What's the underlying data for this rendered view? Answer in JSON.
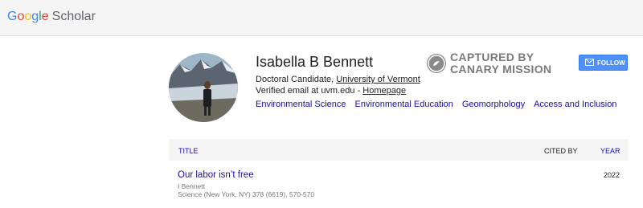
{
  "header": {
    "logo_letters": [
      "G",
      "o",
      "o",
      "g",
      "l",
      "e"
    ],
    "logo_suffix": "Scholar"
  },
  "profile": {
    "name": "Isabella B Bennett",
    "role": "Doctoral Candidate, ",
    "affiliation": "University of Vermont",
    "email_text": "Verified email at uvm.edu - ",
    "homepage_label": "Homepage",
    "interests": [
      "Environmental Science",
      "Environmental Education",
      "Geomorphology",
      "Access and Inclusion"
    ]
  },
  "stamp": {
    "line1": "CAPTURED BY",
    "line2": "CANARY MISSION"
  },
  "follow_button": {
    "label": "FOLLOW"
  },
  "table": {
    "col_title": "TITLE",
    "col_cited": "CITED BY",
    "col_year": "YEAR",
    "rows": [
      {
        "title": "Our labor isn’t free",
        "authors": "I Bennett",
        "venue": "Science (New York, NY) 378 (6619), 570-570",
        "cited_by": "",
        "year": "2022"
      }
    ]
  },
  "colors": {
    "link": "#1a0dab",
    "follow_button": "#4d90fe"
  }
}
